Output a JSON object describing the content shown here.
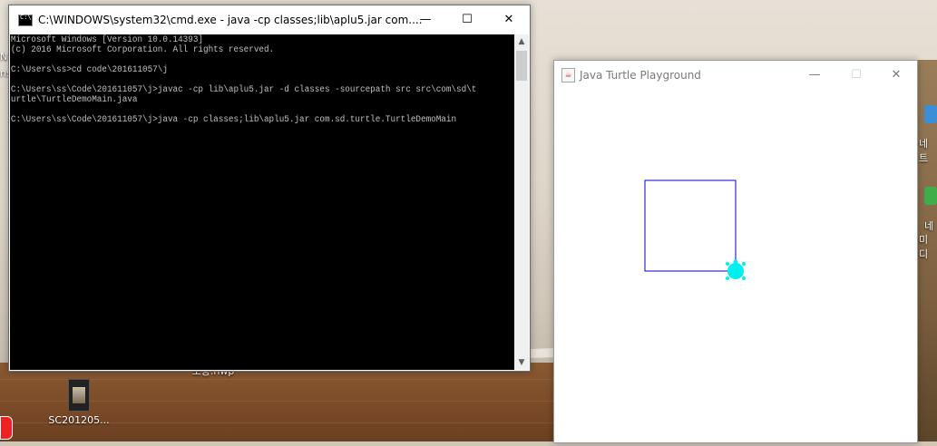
{
  "desktop": {
    "icons": [
      {
        "label": "SC201205...",
        "kind": "image-file"
      },
      {
        "label": "보증.hwp",
        "kind": "document"
      }
    ],
    "side_labels": [
      "N",
      "ns",
      "네트",
      "네",
      "미디"
    ]
  },
  "cmd": {
    "title": "C:\\WINDOWS\\system32\\cmd.exe - java  -cp classes;lib\\aplu5.jar com....",
    "lines": [
      "Microsoft Windows [Version 10.0.14393]",
      "(c) 2016 Microsoft Corporation. All rights reserved.",
      "",
      "C:\\Users\\ss>cd code\\201611057\\j",
      "",
      "C:\\Users\\ss\\Code\\201611057\\j>javac -cp lib\\aplu5.jar -d classes -sourcepath src src\\com\\sd\\t",
      "urtle\\TurtleDemoMain.java",
      "",
      "C:\\Users\\ss\\Code\\201611057\\j>java -cp classes;lib\\aplu5.jar com.sd.turtle.TurtleDemoMain"
    ],
    "text_color": "#c0c0c0",
    "background": "#000000",
    "caption": {
      "minimize": "—",
      "maximize": "☐",
      "close": "✕"
    }
  },
  "turtle_window": {
    "title": "Java Turtle Playground",
    "caption": {
      "minimize": "—",
      "maximize": "☐",
      "close": "✕"
    },
    "maximize_enabled": false,
    "drawing": {
      "path_color": "#0000cc",
      "turtle_color": "#00f0f0",
      "square_side_units": 100
    }
  }
}
